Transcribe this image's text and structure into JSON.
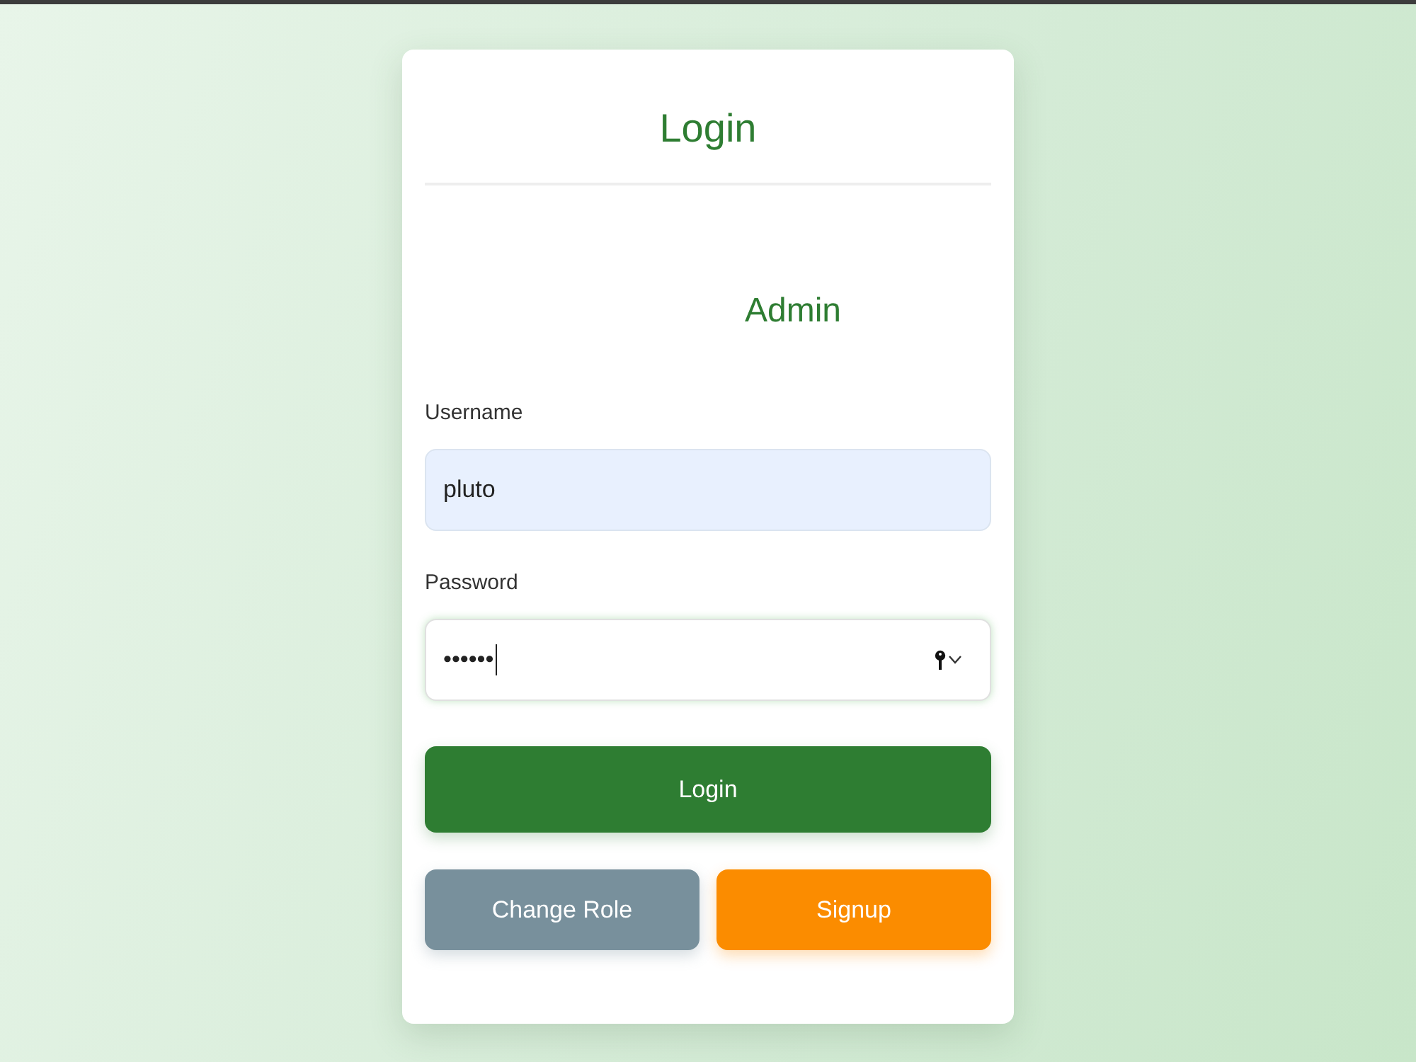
{
  "card": {
    "title": "Login",
    "role": "Admin"
  },
  "fields": [
    {
      "label": "Username",
      "value": "pluto",
      "autofilled": true,
      "focused": false,
      "kind": "text"
    },
    {
      "label": "Password",
      "value": "••••••",
      "autofilled": false,
      "focused": true,
      "kind": "password"
    }
  ],
  "primary_button": {
    "label": "Login",
    "kind": "primary"
  },
  "buttons": [
    {
      "label": "Change Role",
      "kind": "secondary"
    },
    {
      "label": "Signup",
      "kind": "warning"
    }
  ]
}
